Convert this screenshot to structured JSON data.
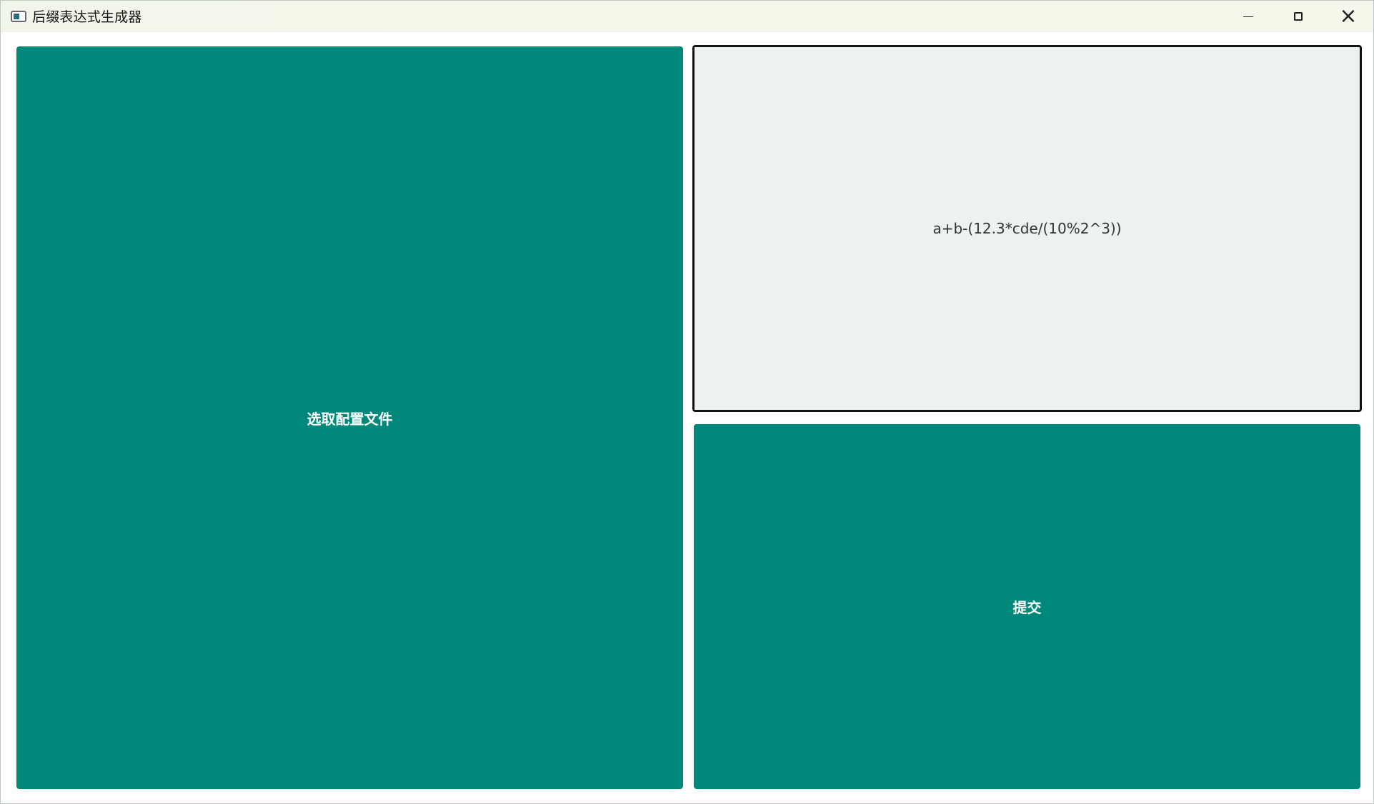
{
  "window": {
    "title": "后缀表达式生成器"
  },
  "controls": {
    "minimize": "minimize-icon",
    "maximize": "maximize-icon",
    "close": "close-icon"
  },
  "main": {
    "select_config_button": "选取配置文件",
    "expression_value": "a+b-(12.3*cde/(10%2^3))",
    "submit_button": "提交"
  },
  "colors": {
    "accent": "#00897b",
    "input_bg": "#edf1f1",
    "border": "#111111"
  }
}
